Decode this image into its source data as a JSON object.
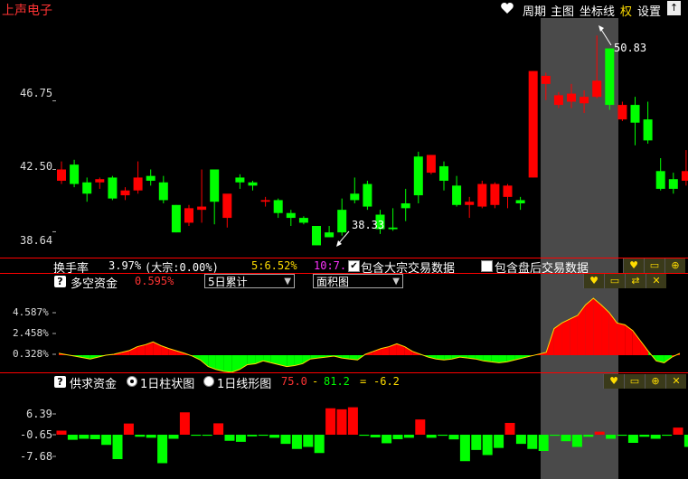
{
  "header": {
    "stock_name": "上声电子",
    "menu": [
      "周期",
      "主图",
      "坐标线",
      "权",
      "设置"
    ],
    "heart_icon": "heart-icon",
    "arrow_button": "↑"
  },
  "main_chart": {
    "y_labels": [
      "46.75",
      "42.50",
      "38.64"
    ],
    "high_marker": "50.83",
    "low_marker": "38.33",
    "candles": [
      [
        41.8,
        42.5,
        41.6,
        43.0
      ],
      [
        42.8,
        41.6,
        41.4,
        43.1
      ],
      [
        41.7,
        41.0,
        40.5,
        42.0
      ],
      [
        41.7,
        41.9,
        41.3,
        42.0
      ],
      [
        42.0,
        40.7,
        40.6,
        42.1
      ],
      [
        40.9,
        41.2,
        40.6,
        41.4
      ],
      [
        41.2,
        42.0,
        41.0,
        43.0
      ],
      [
        42.1,
        41.8,
        41.5,
        42.5
      ],
      [
        41.7,
        40.6,
        40.4,
        42.1
      ],
      [
        40.3,
        38.6,
        38.6,
        40.3
      ],
      [
        39.2,
        40.1,
        39.0,
        40.3
      ],
      [
        40.0,
        40.2,
        39.2,
        42.5
      ],
      [
        42.5,
        40.5,
        39.1,
        42.5
      ],
      [
        39.5,
        41.0,
        38.9,
        40.6
      ],
      [
        42.0,
        41.7,
        41.3,
        42.2
      ],
      [
        41.7,
        41.5,
        41.2,
        41.8
      ],
      [
        40.5,
        40.6,
        40.2,
        40.8
      ],
      [
        40.6,
        39.8,
        39.5,
        40.7
      ],
      [
        39.8,
        39.5,
        39.0,
        40.0
      ],
      [
        39.5,
        39.2,
        39.1,
        39.6
      ],
      [
        39.0,
        37.8,
        37.8,
        39.0
      ],
      [
        38.6,
        38.3,
        38.3,
        39.0
      ],
      [
        40.0,
        38.6,
        38.4,
        40.7
      ],
      [
        41.0,
        40.6,
        40.4,
        42.0
      ],
      [
        41.6,
        40.2,
        40.0,
        41.8
      ],
      [
        39.7,
        38.8,
        38.5,
        40.0
      ],
      [
        38.9,
        38.8,
        38.7,
        40.1
      ],
      [
        40.4,
        40.1,
        39.3,
        41.3
      ],
      [
        43.3,
        40.9,
        40.4,
        43.6
      ],
      [
        42.3,
        43.4,
        42.2,
        43.4
      ],
      [
        42.7,
        41.8,
        41.2,
        43.0
      ],
      [
        41.5,
        40.3,
        40.2,
        42.1
      ],
      [
        40.3,
        40.5,
        39.5,
        40.8
      ],
      [
        40.2,
        41.6,
        40.1,
        41.8
      ],
      [
        40.3,
        41.6,
        40.1,
        41.7
      ],
      [
        40.8,
        41.5,
        40.1,
        41.6
      ],
      [
        40.6,
        40.4,
        40.0,
        40.8
      ],
      [
        42.0,
        48.6,
        42.0,
        48.6
      ],
      [
        47.8,
        48.3,
        46.8,
        48.5
      ],
      [
        46.5,
        47.1,
        46.3,
        47.3
      ],
      [
        46.7,
        47.2,
        46.3,
        47.8
      ],
      [
        46.6,
        47.0,
        46.0,
        47.4
      ],
      [
        47.0,
        48.0,
        46.9,
        50.8
      ],
      [
        50.0,
        46.5,
        46.2,
        50.0
      ],
      [
        45.6,
        46.5,
        45.5,
        46.7
      ],
      [
        46.5,
        45.4,
        44.0,
        47.0
      ],
      [
        45.6,
        44.3,
        44.1,
        46.7
      ],
      [
        42.4,
        41.3,
        41.2,
        43.2
      ],
      [
        41.9,
        41.3,
        41.0,
        42.3
      ],
      [
        41.8,
        42.4,
        41.5,
        43.7
      ]
    ]
  },
  "turnover_bar": {
    "label": "换手率",
    "value": "3.97%",
    "dazong": "(大宗:0.00%)",
    "cum5": "5:6.52%",
    "cum10": "10:7.",
    "checkbox1": "包含大宗交易数据",
    "checkbox2": "包含盘后交易数据"
  },
  "panel1": {
    "title": "多空资金",
    "value": "0.595%",
    "select1": "5日累计",
    "select2": "面积图",
    "y_labels": [
      "4.587%",
      "2.458%",
      "0.328%"
    ],
    "area_values": [
      0.2,
      0.05,
      -0.1,
      -0.25,
      -0.4,
      -0.2,
      0.0,
      0.1,
      0.3,
      0.5,
      0.9,
      1.1,
      1.4,
      1.0,
      0.7,
      0.45,
      0.2,
      -0.1,
      -0.5,
      -1.2,
      -1.5,
      -1.7,
      -1.8,
      -1.5,
      -1.0,
      -0.9,
      -0.6,
      -0.8,
      -1.0,
      -1.2,
      -1.1,
      -0.9,
      -0.4,
      -0.3,
      -0.2,
      -0.1,
      -0.3,
      -0.4,
      -0.5,
      0.1,
      0.4,
      0.7,
      0.9,
      1.2,
      0.9,
      0.4,
      0.1,
      -0.2,
      -0.4,
      -0.5,
      -0.4,
      -0.2,
      -0.3,
      -0.4,
      -0.6,
      -0.7,
      -0.8,
      -0.7,
      -0.5,
      -0.3,
      -0.1,
      0.1,
      0.3,
      2.8,
      3.4,
      3.8,
      4.2,
      5.3,
      6.0,
      5.3,
      4.5,
      3.4,
      3.2,
      2.6,
      1.5,
      0.4,
      -0.6,
      -0.8,
      -0.2,
      0.2
    ]
  },
  "panel2": {
    "title": "供求资金",
    "radio1": "1日柱状图",
    "radio2": "1日线形图",
    "val_a": "75.0",
    "val_minus": "-",
    "val_b": "81.2",
    "val_eq": "=",
    "val_c": "-6.2",
    "y_labels": [
      "6.39",
      "-0.65",
      "-7.68"
    ],
    "bars": [
      2.0,
      -2.5,
      -2.0,
      -2.2,
      -5.0,
      -12.0,
      5.5,
      -1.0,
      -1.5,
      -14.0,
      -2.0,
      11.0,
      -0.5,
      -0.5,
      5.6,
      -3.0,
      -3.5,
      -0.8,
      -0.5,
      -1.5,
      -4.5,
      -7.0,
      -6.0,
      -9.0,
      13.0,
      12.5,
      13.5,
      -0.5,
      -1.3,
      -4.2,
      -2.2,
      -1.5,
      7.5,
      -1.5,
      -0.5,
      -2.3,
      -13.0,
      -7.5,
      -10.0,
      -6.5,
      5.8,
      -4.5,
      -7.0,
      -8.0,
      -0.5,
      -3.2,
      -6.0,
      -1.0,
      1.5,
      -2.0,
      -0.5,
      -4.0,
      -1.0,
      -2.0,
      -0.5,
      3.5,
      -6.0
    ]
  },
  "colors": {
    "up": "#ff0000",
    "down": "#00ff00",
    "highlight": "#4a4a4a",
    "axis_line": "#cc0000",
    "title_red": "#ff3333",
    "yellow": "#ffdd00",
    "magenta": "#ff33ff"
  }
}
